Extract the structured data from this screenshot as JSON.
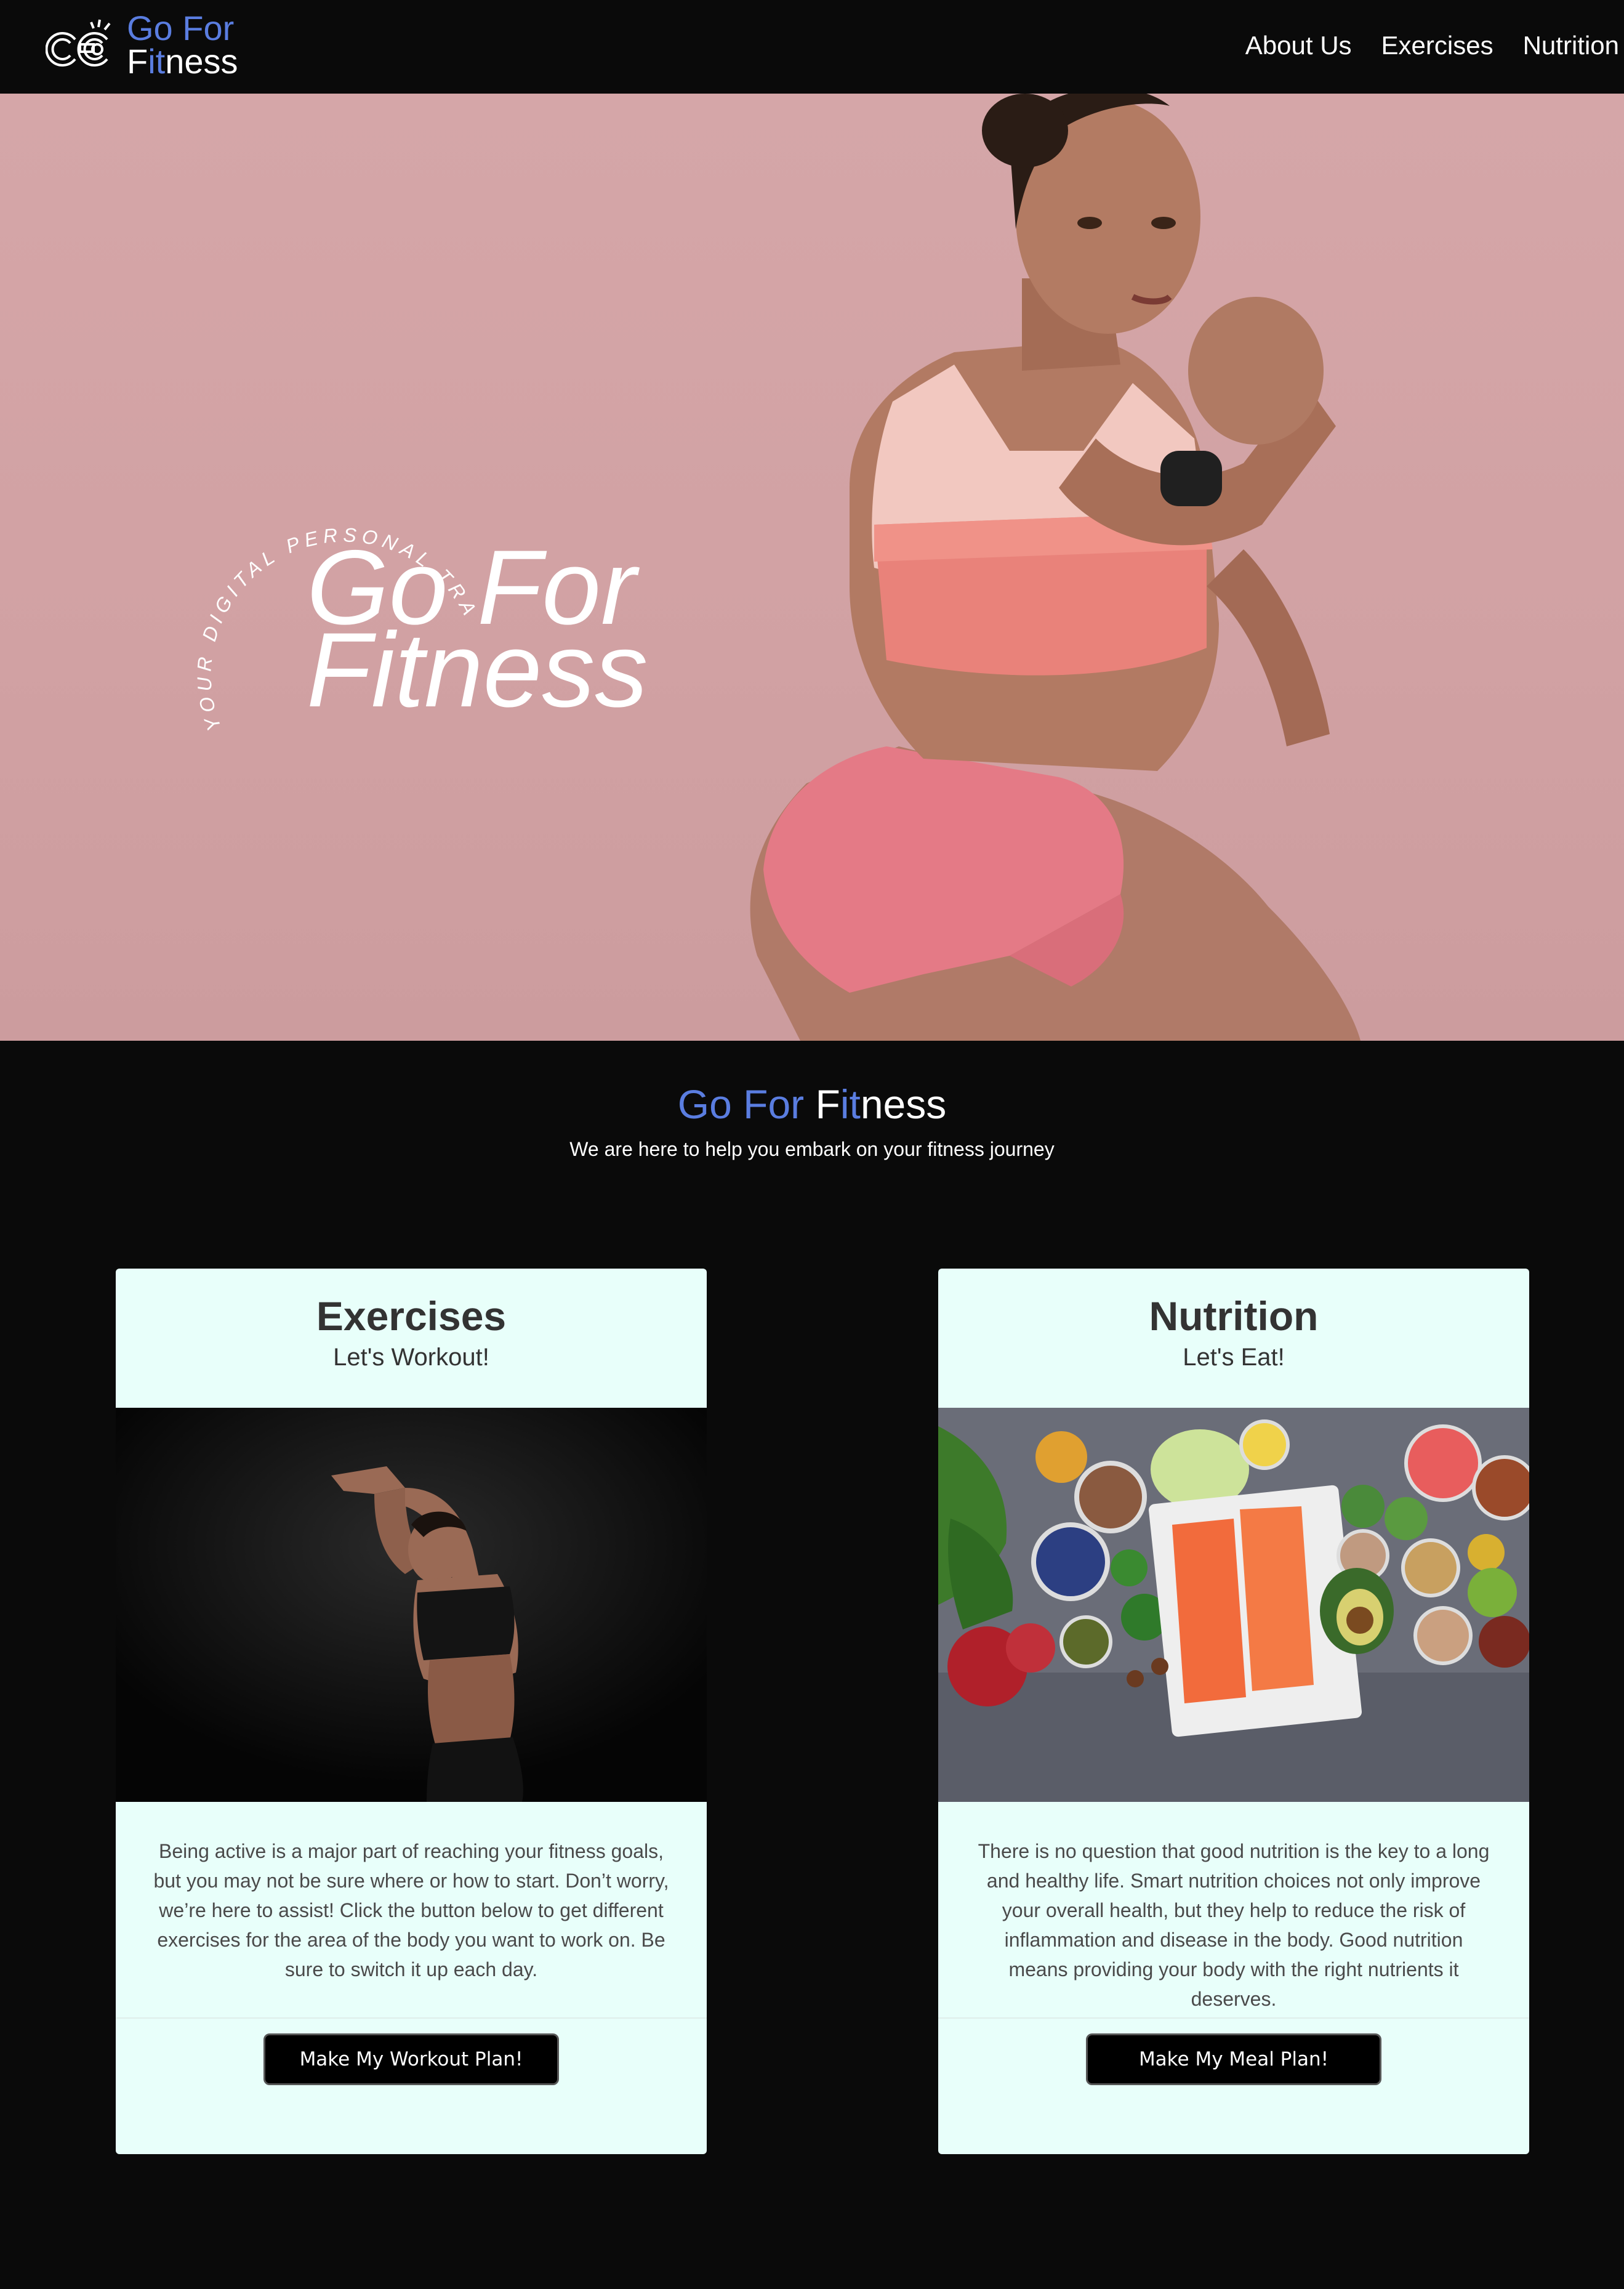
{
  "brand": {
    "logo_line1": "Go For",
    "logo_line2_a": "F",
    "logo_line2_b": "it",
    "logo_line2_c": "ness",
    "accent_color": "#5a7de0"
  },
  "nav": {
    "items": [
      {
        "label": "About Us"
      },
      {
        "label": "Exercises"
      },
      {
        "label": "Nutrition"
      }
    ]
  },
  "hero": {
    "arc_text": "YOUR DIGITAL PERSONAL TRAINER",
    "title_line1": "Go For",
    "title_line2": "Fitness",
    "background_color": "#d3a3a5"
  },
  "intro": {
    "title_a": "Go For",
    "title_b": "F",
    "title_c": "it",
    "title_d": "ness",
    "subtitle": "We are here to help you embark on your fitness journey"
  },
  "cards": [
    {
      "title": "Exercises",
      "subtitle": "Let's Workout!",
      "image_icon": "woman-stretching-image",
      "body": "Being active is a major part of reaching your fitness goals, but you may not be sure where or how to start. Don’t worry, we’re here to assist! Click the button below to get different exercises for the area of the body you want to work on. Be sure to switch it up each day.",
      "button_label": "Make My Workout Plan!"
    },
    {
      "title": "Nutrition",
      "subtitle": "Let's Eat!",
      "image_icon": "healthy-food-image",
      "body": "There is no question that good nutrition is the key to a long and healthy life. Smart nutrition choices not only improve your overall health, but they help to reduce the risk of inflammation and disease in the body. Good nutrition means providing your body with the right nutrients it deserves.",
      "button_label": "Make My Meal Plan!"
    }
  ]
}
